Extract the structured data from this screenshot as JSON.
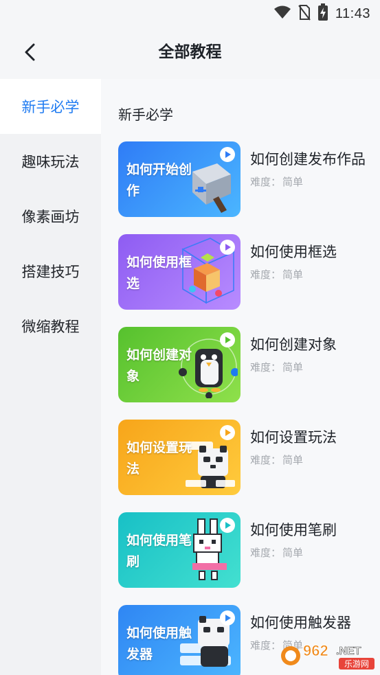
{
  "status": {
    "time": "11:43"
  },
  "header": {
    "title": "全部教程"
  },
  "sidebar": {
    "items": [
      {
        "label": "新手必学",
        "active": true
      },
      {
        "label": "趣味玩法",
        "active": false
      },
      {
        "label": "像素画坊",
        "active": false
      },
      {
        "label": "搭建技巧",
        "active": false
      },
      {
        "label": "微缩教程",
        "active": false
      }
    ]
  },
  "main": {
    "section_title": "新手必学",
    "difficulty_label": "难度：",
    "tutorials": [
      {
        "thumb_text": "如何开始创作",
        "title": "如何创建发布作品",
        "difficulty": "简单",
        "color_from": "#2f7cf6",
        "color_to": "#4bb6ff"
      },
      {
        "thumb_text": "如何使用框选",
        "title": "如何使用框选",
        "difficulty": "简单",
        "color_from": "#8e5cf2",
        "color_to": "#b88cff"
      },
      {
        "thumb_text": "如何创建对象",
        "title": "如何创建对象",
        "difficulty": "简单",
        "color_from": "#56c12e",
        "color_to": "#8fe04b"
      },
      {
        "thumb_text": "如何设置玩法",
        "title": "如何设置玩法",
        "difficulty": "简单",
        "color_from": "#f7a51a",
        "color_to": "#ffcb3d"
      },
      {
        "thumb_text": "如何使用笔刷",
        "title": "如何使用笔刷",
        "difficulty": "简单",
        "color_from": "#18c0c6",
        "color_to": "#43e0d0"
      },
      {
        "thumb_text": "如何使用触发器",
        "title": "如何使用触发器",
        "difficulty": "简单",
        "color_from": "#2f86f3",
        "color_to": "#4cb6ff"
      }
    ]
  },
  "watermark": {
    "brand_number": "962",
    "brand_suffix": ".NET",
    "tagline": "乐游网"
  },
  "colors": {
    "accent": "#1f7bf1",
    "text_primary": "#1f2329",
    "text_secondary": "#a4a8ae",
    "sidebar_bg": "#f1f2f4"
  },
  "icons": {
    "back": "chevron-left-icon",
    "play": "play-icon",
    "wifi": "wifi-icon",
    "no_sim": "no-sim-icon",
    "battery": "battery-charging-icon"
  }
}
